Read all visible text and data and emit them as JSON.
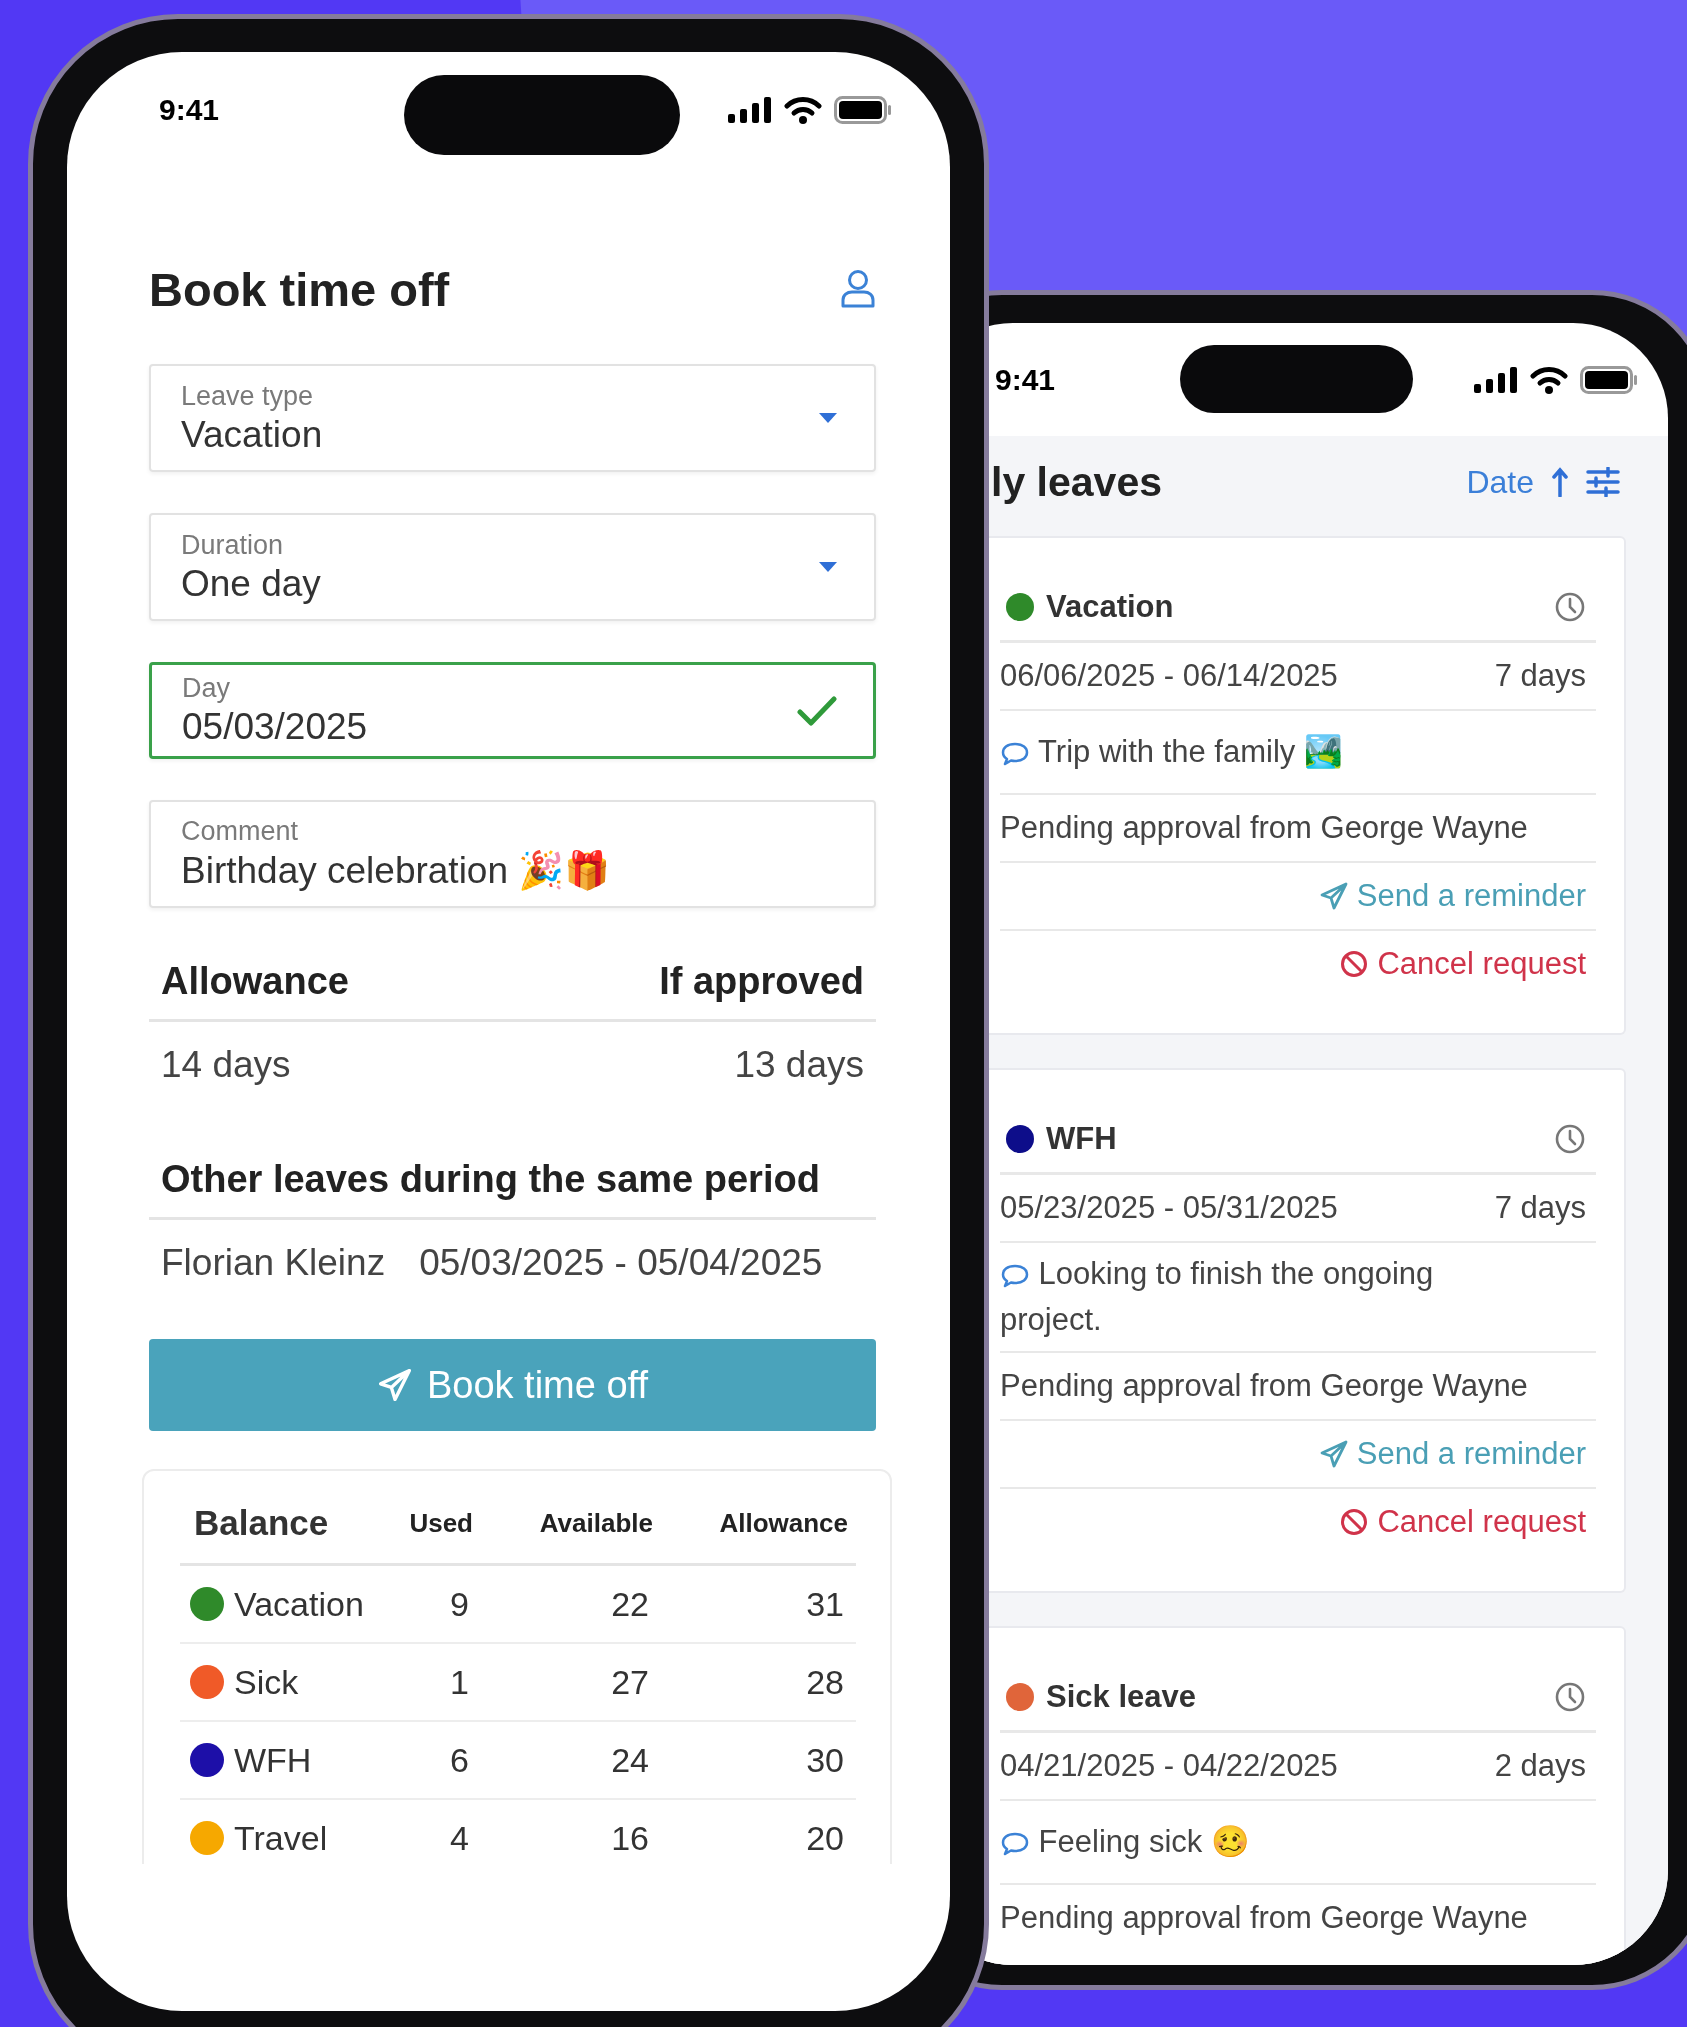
{
  "booking_screen": {
    "status_bar": {
      "time": "9:41"
    },
    "title": "Book time off",
    "fields": [
      {
        "kind": "select",
        "label": "Leave type",
        "value": "Vacation",
        "valid": false
      },
      {
        "kind": "select",
        "label": "Duration",
        "value": "One day",
        "valid": false
      },
      {
        "kind": "date",
        "label": "Day",
        "value": "05/03/2025",
        "valid": true
      },
      {
        "kind": "text",
        "label": "Comment",
        "value": "Birthday celebration 🎉🎁",
        "valid": false
      }
    ],
    "allowance": {
      "headers": [
        "Allowance",
        "If approved"
      ],
      "values": [
        "14 days",
        "13 days"
      ]
    },
    "other_leaves": {
      "title": "Other leaves during the same period",
      "rows": [
        {
          "name": "Florian Kleinz",
          "period": "05/03/2025 - 05/04/2025"
        }
      ]
    },
    "submit_button": "Book time off",
    "balance": {
      "columns": [
        "Balance",
        "Used",
        "Available",
        "Allowance"
      ],
      "rows": [
        {
          "type": "Vacation",
          "color": "#2f8a2a",
          "used": "9",
          "available": "22",
          "allowance": "31"
        },
        {
          "type": "Sick",
          "color": "#f05a28",
          "used": "1",
          "available": "27",
          "allowance": "28"
        },
        {
          "type": "WFH",
          "color": "#1d0fa8",
          "used": "6",
          "available": "24",
          "allowance": "30"
        },
        {
          "type": "Travel",
          "color": "#f6a800",
          "used": "4",
          "available": "16",
          "allowance": "20"
        }
      ]
    }
  },
  "leaves_screen": {
    "status_bar": {
      "time": "9:41"
    },
    "title": "ly leaves",
    "sort": {
      "label": "Date",
      "ascending": true
    },
    "leaves": [
      {
        "type": "Vacation",
        "color": "#2f8a2a",
        "period": "06/06/2025 - 06/14/2025",
        "duration": "7 days",
        "comment": "Trip with the family 🏞️",
        "status": "Pending approval from George Wayne",
        "actions": [
          {
            "kind": "remind",
            "label": "Send a reminder"
          },
          {
            "kind": "cancel",
            "label": "Cancel request"
          }
        ]
      },
      {
        "type": "WFH",
        "color": "#0d0d8a",
        "period": "05/23/2025 - 05/31/2025",
        "duration": "7 days",
        "comment": "Looking to finish the ongoing project.",
        "status": "Pending approval from George Wayne",
        "actions": [
          {
            "kind": "remind",
            "label": "Send a reminder"
          },
          {
            "kind": "cancel",
            "label": "Cancel request"
          }
        ]
      },
      {
        "type": "Sick leave",
        "color": "#e0653a",
        "period": "04/21/2025 - 04/22/2025",
        "duration": "2 days",
        "comment": "Feeling sick 🥴",
        "status": "Pending approval from George Wayne"
      }
    ]
  }
}
